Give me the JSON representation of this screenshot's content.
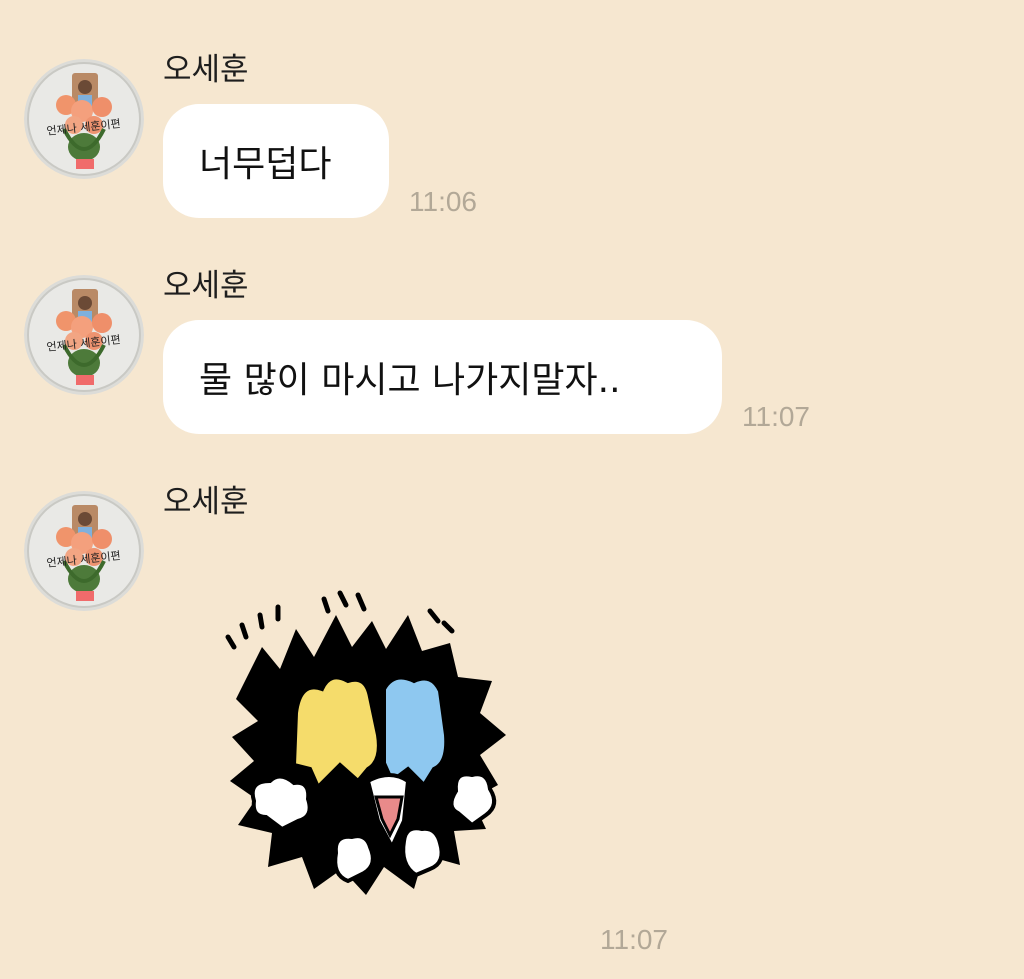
{
  "colors": {
    "background": "#f6e7d0",
    "bubble": "#ffffff",
    "timestamp": "#b2a897"
  },
  "messages": [
    {
      "sender": "오세훈",
      "text": "너무덥다",
      "time": "11:06",
      "avatar_text": "언제나 세훈이편"
    },
    {
      "sender": "오세훈",
      "text": "물 많이 마시고 나가지말자..",
      "time": "11:07",
      "avatar_text": "언제나 세훈이편"
    },
    {
      "sender": "오세훈",
      "sticker": "panicking-black-creature-sticker",
      "time": "11:07",
      "avatar_text": "언제나 세훈이편"
    }
  ]
}
